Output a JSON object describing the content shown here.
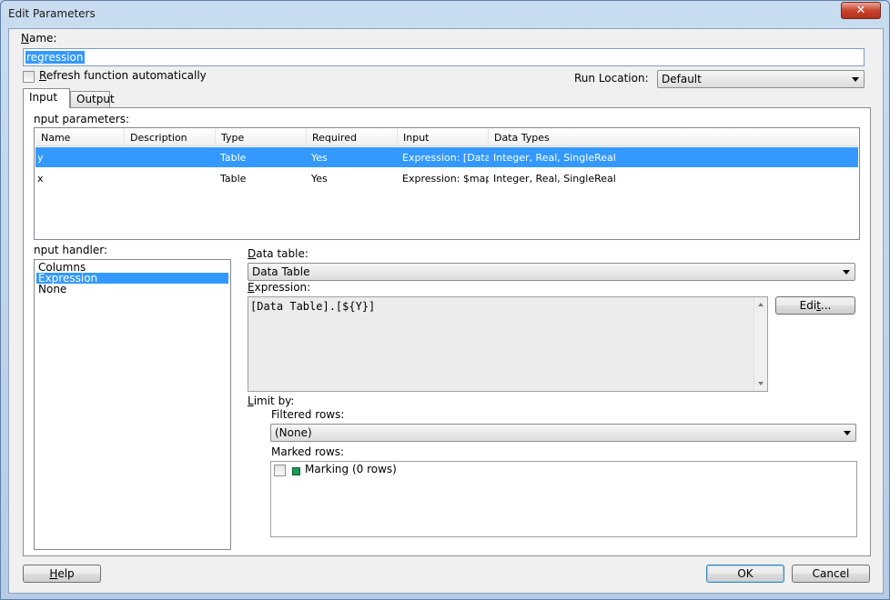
{
  "window": {
    "title": "Edit Parameters",
    "close_glyph": "✕"
  },
  "name": {
    "label_u": "N",
    "label_rest": "ame:",
    "value": "regression"
  },
  "refresh": {
    "label_u": "R",
    "label_rest": "efresh function automatically",
    "checked": false
  },
  "run_location": {
    "label": "Run Location:",
    "value": "Default"
  },
  "tabs": [
    {
      "label": "Input"
    },
    {
      "label": "Output"
    }
  ],
  "input_parameters": {
    "label": "nput parameters:",
    "columns": [
      "Name",
      "Description",
      "Type",
      "Required",
      "Input",
      "Data Types"
    ],
    "rows": [
      {
        "name": "y",
        "description": "",
        "type": "Table",
        "required": "Yes",
        "input": "Expression: [Data...",
        "data_types": "Integer, Real, SingleReal",
        "selected": true
      },
      {
        "name": "x",
        "description": "",
        "type": "Table",
        "required": "Yes",
        "input": "Expression: $map...",
        "data_types": "Integer, Real, SingleReal",
        "selected": false
      }
    ]
  },
  "input_handler": {
    "label": "nput handler:",
    "items": [
      {
        "label": "Columns",
        "selected": false
      },
      {
        "label": "Expression",
        "selected": true
      },
      {
        "label": "None",
        "selected": false
      }
    ]
  },
  "data_table": {
    "label_u": "D",
    "label_rest": "ata table:",
    "value": "Data Table"
  },
  "expression": {
    "label_u": "E",
    "label_rest": "xpression:",
    "value": "[Data Table].[${Y}]"
  },
  "edit_button": {
    "label_pre": "Edi",
    "label_u": "t",
    "label_post": "..."
  },
  "limit_by": {
    "label_u": "L",
    "label_rest": "imit by:",
    "filtered_rows": {
      "label": "Filtered rows:",
      "value": "(None)"
    },
    "marked_rows": {
      "label": "Marked rows:",
      "items": [
        {
          "label": "Marking (0 rows)",
          "checked": false,
          "color": "#1a9a55"
        }
      ]
    }
  },
  "buttons": {
    "help": "Help",
    "help_u": "H",
    "help_rest": "elp",
    "ok": "OK",
    "cancel": "Cancel"
  },
  "colors": {
    "selection": "#3399ff",
    "marking": "#1a9a55"
  }
}
